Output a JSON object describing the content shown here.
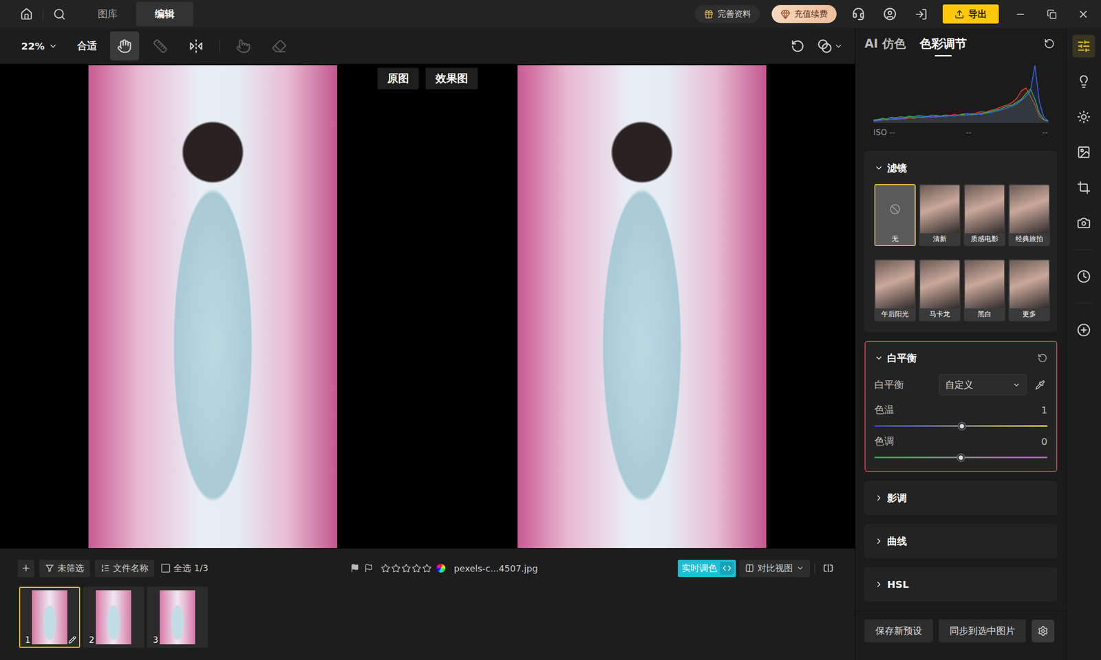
{
  "top_bar": {
    "tabs": [
      {
        "label": "图库",
        "selected": false
      },
      {
        "label": "编辑",
        "selected": true
      }
    ],
    "profile_button": "完善资料",
    "recharge_button": "充值续费",
    "export_button": "导出"
  },
  "toolbar": {
    "zoom": "22%",
    "fit": "合适",
    "tools": [
      {
        "kind": "hand",
        "selected": true,
        "disabled": false
      },
      {
        "kind": "ruler",
        "selected": false,
        "disabled": true
      },
      {
        "kind": "flip",
        "selected": false,
        "disabled": false
      },
      {
        "kind": "touch",
        "selected": false,
        "disabled": true
      },
      {
        "kind": "eraser",
        "selected": false,
        "disabled": true
      }
    ]
  },
  "canvas": {
    "labels": [
      "原图",
      "效果图"
    ]
  },
  "filter_bar": {
    "filter_button": "未筛选",
    "sort_button": "文件名称",
    "select_all": {
      "label": "全选 1/3",
      "checked": false
    },
    "flags": [
      {
        "kind": "pick",
        "on": false
      },
      {
        "kind": "reject",
        "on": false
      }
    ],
    "stars": 0,
    "max_stars": 5,
    "filename": "pexels-c...4507.jpg",
    "live_button": {
      "label": "实时调色",
      "on": true
    },
    "view_button": "对比视图"
  },
  "thumbnails": [
    {
      "number": "1",
      "selected": true,
      "edited": true
    },
    {
      "number": "2",
      "selected": false,
      "edited": false
    },
    {
      "number": "3",
      "selected": false,
      "edited": false
    }
  ],
  "panel": {
    "tabs": [
      {
        "label": "AI 仿色",
        "selected": false
      },
      {
        "label": "色彩调节",
        "selected": true
      }
    ],
    "histogram": {
      "series": [
        {
          "color": "#e0403a",
          "values": [
            2,
            3,
            4,
            3,
            5,
            4,
            6,
            5,
            7,
            6,
            8,
            7,
            9,
            8,
            10,
            9,
            12,
            11,
            13,
            12,
            14,
            15,
            13,
            16,
            18,
            17,
            20,
            22,
            25,
            28,
            30,
            35,
            42,
            55,
            60,
            45,
            30,
            10,
            3,
            1
          ]
        },
        {
          "color": "#3cb84a",
          "values": [
            3,
            4,
            6,
            5,
            8,
            7,
            9,
            8,
            10,
            9,
            11,
            10,
            9,
            12,
            11,
            10,
            12,
            11,
            10,
            12,
            13,
            12,
            14,
            13,
            15,
            16,
            18,
            20,
            22,
            25,
            28,
            30,
            35,
            40,
            50,
            58,
            40,
            15,
            4,
            1
          ]
        },
        {
          "color": "#3a6cf0",
          "values": [
            1,
            2,
            3,
            4,
            5,
            6,
            5,
            7,
            8,
            7,
            9,
            8,
            10,
            9,
            8,
            10,
            9,
            11,
            10,
            12,
            11,
            13,
            12,
            14,
            13,
            15,
            16,
            18,
            20,
            22,
            25,
            28,
            32,
            38,
            45,
            55,
            100,
            35,
            8,
            1
          ]
        }
      ],
      "readings": [
        "ISO --",
        "--",
        "--"
      ]
    },
    "filters": {
      "title": "滤镜",
      "expanded": true,
      "items": [
        {
          "label": "无",
          "kind": "none",
          "selected": true
        },
        {
          "label": "清新",
          "kind": "photo",
          "selected": false
        },
        {
          "label": "质感电影",
          "kind": "photo",
          "selected": false
        },
        {
          "label": "经典旅拍",
          "kind": "photo",
          "selected": false
        },
        {
          "label": "午后阳光",
          "kind": "photo",
          "selected": false
        },
        {
          "label": "马卡龙",
          "kind": "photo",
          "selected": false
        },
        {
          "label": "黑白",
          "kind": "photo",
          "selected": false
        },
        {
          "label": "更多",
          "kind": "photo",
          "selected": false
        }
      ]
    },
    "white_balance": {
      "title": "白平衡",
      "expanded": true,
      "highlighted": true,
      "mode_label": "白平衡",
      "mode": "自定义",
      "sliders": [
        {
          "label": "色温",
          "kind": "temperature",
          "reading": "1",
          "level": 0.506
        },
        {
          "label": "色调",
          "kind": "tint",
          "reading": "0",
          "level": 0.5
        }
      ]
    },
    "sections": [
      {
        "title": "影调",
        "expanded": false
      },
      {
        "title": "曲线",
        "expanded": false
      },
      {
        "title": "HSL",
        "expanded": false
      }
    ],
    "buttons": [
      "保存新预设",
      "同步到选中图片"
    ]
  },
  "tool_strip": [
    {
      "kind": "adjust",
      "selected": true
    },
    {
      "kind": "light",
      "selected": false
    },
    {
      "kind": "sun",
      "selected": false
    },
    {
      "kind": "image",
      "selected": false
    },
    {
      "kind": "crop",
      "selected": false
    },
    {
      "kind": "camera",
      "selected": false
    },
    {
      "kind": "history",
      "selected": false
    },
    {
      "kind": "add",
      "selected": false
    }
  ]
}
